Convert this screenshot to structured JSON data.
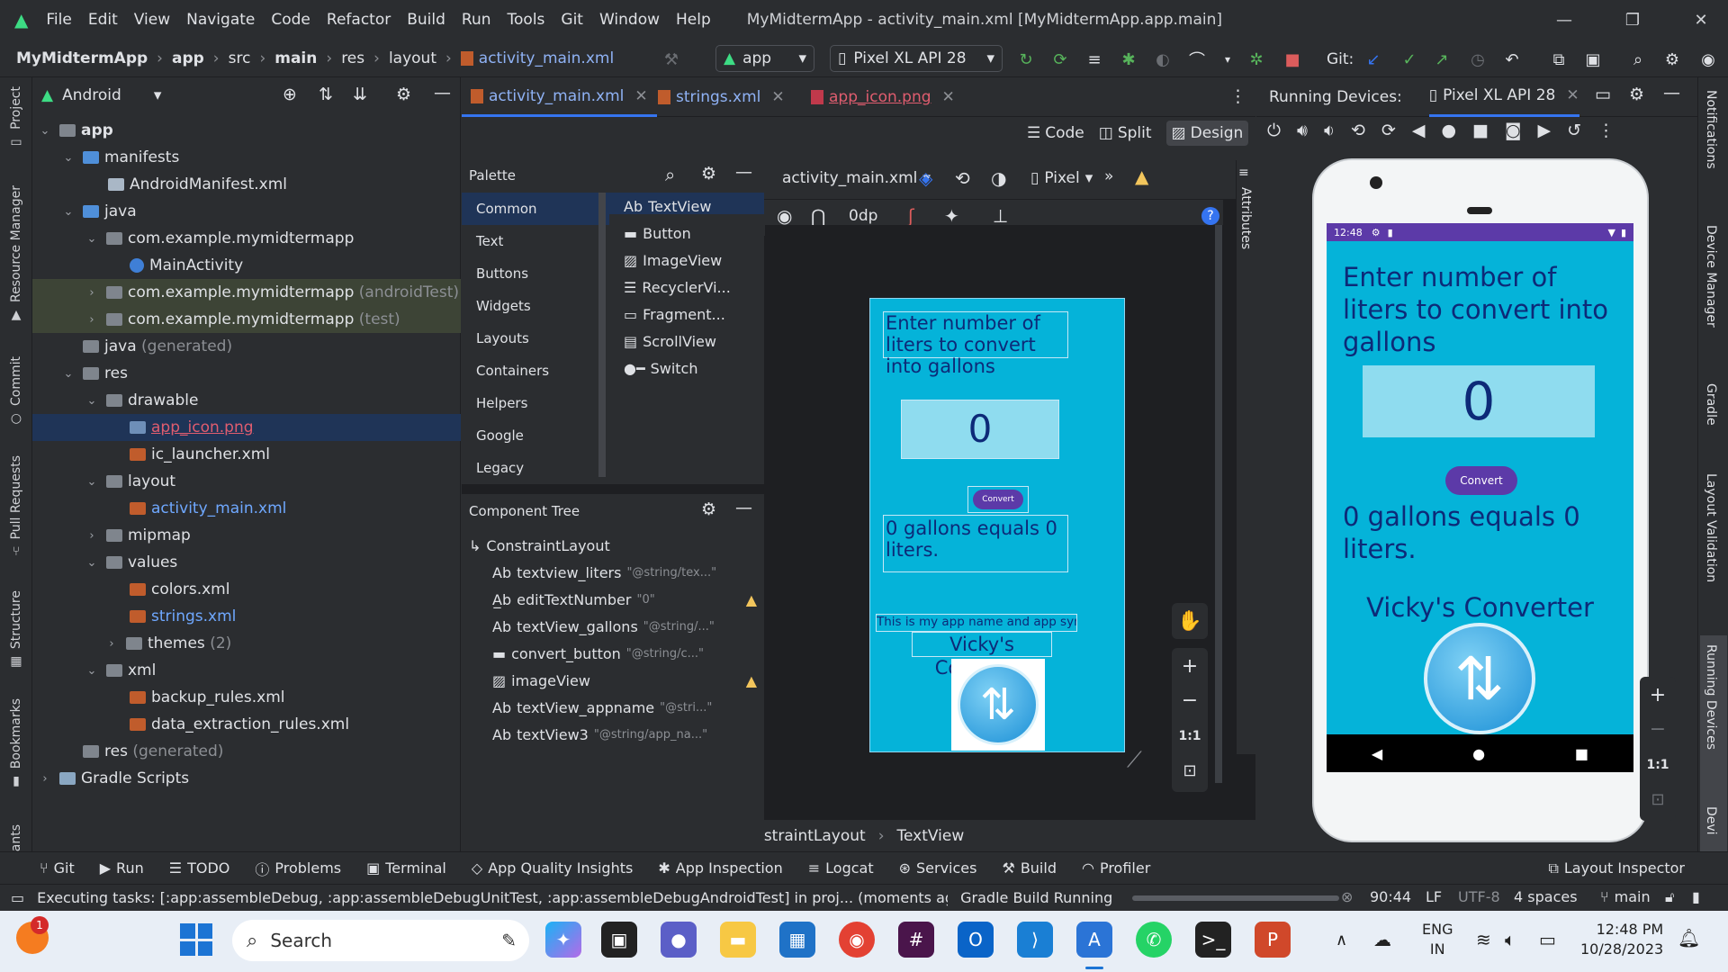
{
  "menu": [
    "File",
    "Edit",
    "View",
    "Navigate",
    "Code",
    "Refactor",
    "Build",
    "Run",
    "Tools",
    "Git",
    "Window",
    "Help"
  ],
  "window_title": "MyMidtermApp - activity_main.xml [MyMidtermApp.app.main]",
  "breadcrumb": {
    "project": "MyMidtermApp",
    "items": [
      "app",
      "src",
      "main",
      "res",
      "layout"
    ],
    "file": "activity_main.xml"
  },
  "toolbar": {
    "run_config": "app",
    "device": "Pixel XL API 28",
    "git_label": "Git:"
  },
  "left_strip": [
    "Project",
    "Resource Manager",
    "Commit",
    "Pull Requests",
    "Structure",
    "Bookmarks",
    "ants"
  ],
  "project_panel": {
    "view": "Android",
    "rows": [
      {
        "label": "app",
        "extra": ""
      },
      {
        "label": "manifests",
        "extra": ""
      },
      {
        "label": "AndroidManifest.xml",
        "extra": ""
      },
      {
        "label": "java",
        "extra": ""
      },
      {
        "label": "com.example.mymidtermapp",
        "extra": ""
      },
      {
        "label": "MainActivity",
        "extra": ""
      },
      {
        "label": "com.example.mymidtermapp",
        "extra": "(androidTest)"
      },
      {
        "label": "com.example.mymidtermapp",
        "extra": "(test)"
      },
      {
        "label": "java",
        "extra": "(generated)"
      },
      {
        "label": "res",
        "extra": ""
      },
      {
        "label": "drawable",
        "extra": ""
      },
      {
        "label": "app_icon.png",
        "extra": ""
      },
      {
        "label": "ic_launcher.xml",
        "extra": ""
      },
      {
        "label": "layout",
        "extra": ""
      },
      {
        "label": "activity_main.xml",
        "extra": ""
      },
      {
        "label": "mipmap",
        "extra": ""
      },
      {
        "label": "values",
        "extra": ""
      },
      {
        "label": "colors.xml",
        "extra": ""
      },
      {
        "label": "strings.xml",
        "extra": ""
      },
      {
        "label": "themes",
        "extra": "(2)"
      },
      {
        "label": "xml",
        "extra": ""
      },
      {
        "label": "backup_rules.xml",
        "extra": ""
      },
      {
        "label": "data_extraction_rules.xml",
        "extra": ""
      },
      {
        "label": "res",
        "extra": "(generated)"
      },
      {
        "label": "Gradle Scripts",
        "extra": ""
      }
    ]
  },
  "editor_tabs": [
    "activity_main.xml",
    "strings.xml",
    "app_icon.png"
  ],
  "view_modes": [
    "Code",
    "Split",
    "Design"
  ],
  "palette": {
    "title": "Palette",
    "categories": [
      "Common",
      "Text",
      "Buttons",
      "Widgets",
      "Layouts",
      "Containers",
      "Helpers",
      "Google",
      "Legacy"
    ],
    "items": [
      "TextView",
      "Button",
      "ImageView",
      "RecyclerVi...",
      "Fragment...",
      "ScrollView",
      "Switch"
    ]
  },
  "design_toolbar": {
    "file": "activity_main.xml",
    "device": "Pixel",
    "margin": "0dp"
  },
  "component_tree": {
    "title": "Component Tree",
    "root": "ConstraintLayout",
    "items": [
      {
        "name": "textview_liters",
        "hint": "\"@string/tex...\""
      },
      {
        "name": "editTextNumber",
        "hint": "\"0\""
      },
      {
        "name": "textView_gallons",
        "hint": "\"@string/...\""
      },
      {
        "name": "convert_button",
        "hint": "\"@string/c...\""
      },
      {
        "name": "imageView",
        "hint": ""
      },
      {
        "name": "textView_appname",
        "hint": "\"@stri...\""
      },
      {
        "name": "textView3",
        "hint": "\"@string/app_na...\""
      }
    ]
  },
  "blueprint": {
    "prompt": "Enter number of liters to convert into gallons",
    "value": "0",
    "button": "Convert",
    "result": "0 gallons equals 0 liters.",
    "caption": "This is my app name and app symbol",
    "app_name": "Vicky's Converter"
  },
  "zoom_controls": [
    "+",
    "−",
    "1:1"
  ],
  "editor_breadcrumb": [
    "androidx.constraintlayout.widget.ConstraintLayout",
    "TextView"
  ],
  "attributes_label": "Attributes",
  "running_devices": {
    "label": "Running Devices:",
    "tab": "Pixel XL API 28"
  },
  "device_screen": {
    "time": "12:48",
    "prompt": "Enter number of liters to convert into gallons",
    "value": "0",
    "button": "Convert",
    "result": "0 gallons equals 0 liters.",
    "app_name": "Vicky's Converter"
  },
  "right_strip": [
    "Notifications",
    "Device Manager",
    "Gradle",
    "Layout Validation",
    "Running Devices",
    "Devi"
  ],
  "tool_windows": [
    "Git",
    "Run",
    "TODO",
    "Problems",
    "Terminal",
    "App Quality Insights",
    "App Inspection",
    "Logcat",
    "Services",
    "Build",
    "Profiler",
    "Layout Inspector"
  ],
  "status": {
    "task": "Executing tasks: [:app:assembleDebug, :app:assembleDebugUnitTest, :app:assembleDebugAndroidTest] in proj... (moments ago",
    "gradle": "Gradle Build Running",
    "position": "90:44",
    "line_sep": "LF",
    "encoding": "UTF-8",
    "indent": "4 spaces",
    "branch": "main"
  },
  "taskbar": {
    "search_placeholder": "Search",
    "lang_top": "ENG",
    "lang_bottom": "IN",
    "time": "12:48 PM",
    "date": "10/28/2023",
    "notification_count": "1"
  },
  "colors": {
    "ide_bg": "#2b2d30",
    "editor_bg": "#1e1f22",
    "app_bg": "#05b3d9",
    "button": "#5c3aa8",
    "accent": "#3574f0"
  }
}
